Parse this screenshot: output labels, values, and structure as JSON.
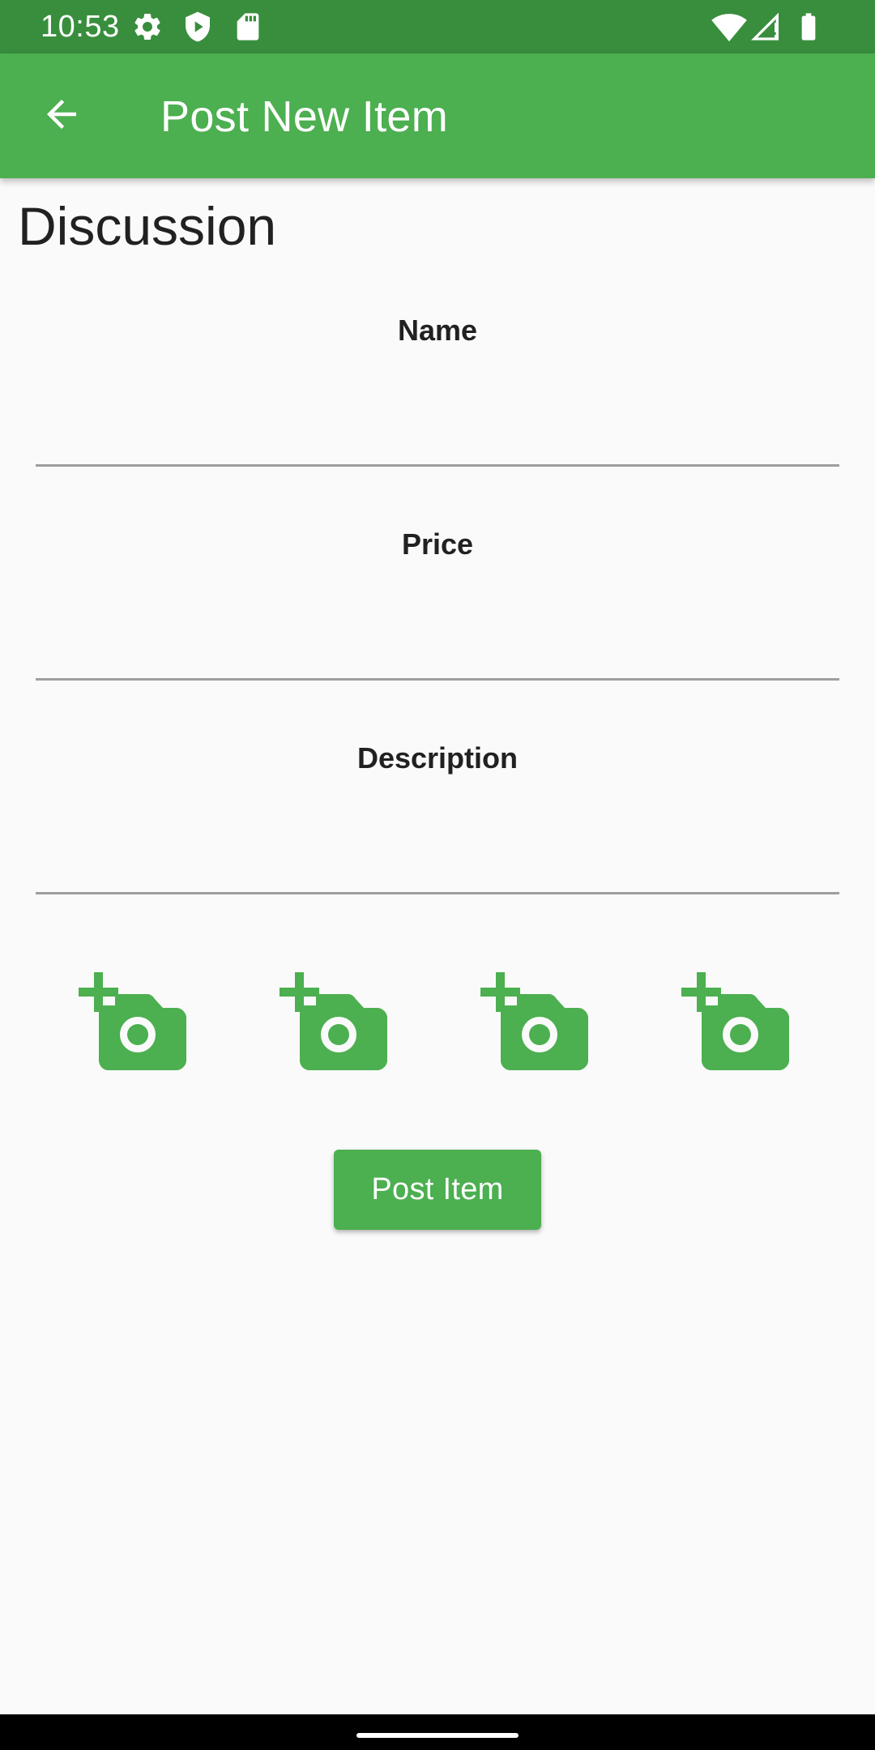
{
  "status_bar": {
    "time": "10:53",
    "left_icons": [
      "settings-icon",
      "shield-icon",
      "sd-card-icon"
    ],
    "right_icons": [
      "wifi-icon",
      "signal-icon",
      "battery-icon"
    ]
  },
  "app_bar": {
    "title": "Post New Item",
    "back_icon": "arrow-back-icon",
    "color": "#4caf50",
    "status_color": "#388e3c"
  },
  "section": {
    "title": "Discussion"
  },
  "form": {
    "fields": [
      {
        "label": "Name",
        "value": ""
      },
      {
        "label": "Price",
        "value": ""
      },
      {
        "label": "Description",
        "value": ""
      }
    ],
    "photo_buttons": [
      "add-photo-icon",
      "add-photo-icon",
      "add-photo-icon",
      "add-photo-icon"
    ],
    "submit_label": "Post Item"
  },
  "colors": {
    "accent": "#4caf50",
    "background": "#fafafa",
    "text": "#212121",
    "underline": "#9e9e9e"
  }
}
